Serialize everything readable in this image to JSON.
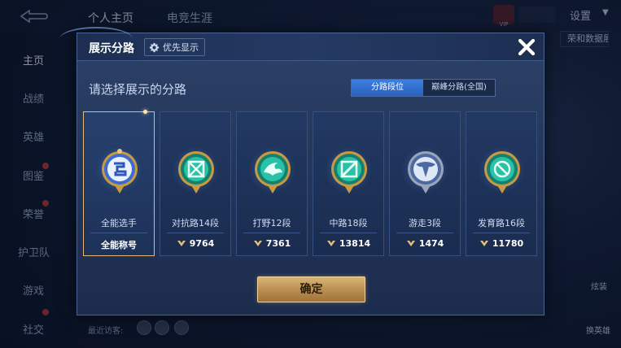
{
  "background": {
    "tabs": [
      "个人主页",
      "电竞生涯"
    ],
    "vip_label": "VIP",
    "settings_label": "设置",
    "sidebar_items": [
      "主页",
      "战绩",
      "英雄",
      "图鉴",
      "荣誉",
      "护卫队",
      "游戏",
      "社交"
    ],
    "right_button": "荣和数据展示",
    "right_labels": [
      "炫装",
      "换英雄"
    ],
    "recent_visitors": "最近访客:"
  },
  "modal": {
    "title": "展示分路",
    "priority_label": "优先显示",
    "subtitle": "请选择展示的分路",
    "segments": [
      {
        "label": "分路段位",
        "active": true
      },
      {
        "label": "巅峰分路(全国)",
        "active": false
      }
    ],
    "cards": [
      {
        "name": "全能选手",
        "footer": "全能称号",
        "score": null,
        "emblem": "all-round-emblem-icon",
        "selected": true
      },
      {
        "name": "对抗路14段",
        "footer": null,
        "score": "9764",
        "emblem": "clash-lane-emblem-icon",
        "selected": false
      },
      {
        "name": "打野12段",
        "footer": null,
        "score": "7361",
        "emblem": "jungle-emblem-icon",
        "selected": false
      },
      {
        "name": "中路18段",
        "footer": null,
        "score": "13814",
        "emblem": "mid-lane-emblem-icon",
        "selected": false
      },
      {
        "name": "游走3段",
        "footer": null,
        "score": "1474",
        "emblem": "roam-emblem-icon",
        "selected": false
      },
      {
        "name": "发育路16段",
        "footer": null,
        "score": "11780",
        "emblem": "farm-lane-emblem-icon",
        "selected": false
      }
    ],
    "confirm_label": "确定"
  },
  "colors": {
    "accent_blue": "#3d7fe0",
    "gold": "#e6b97a",
    "teal": "#1fb7a4"
  }
}
